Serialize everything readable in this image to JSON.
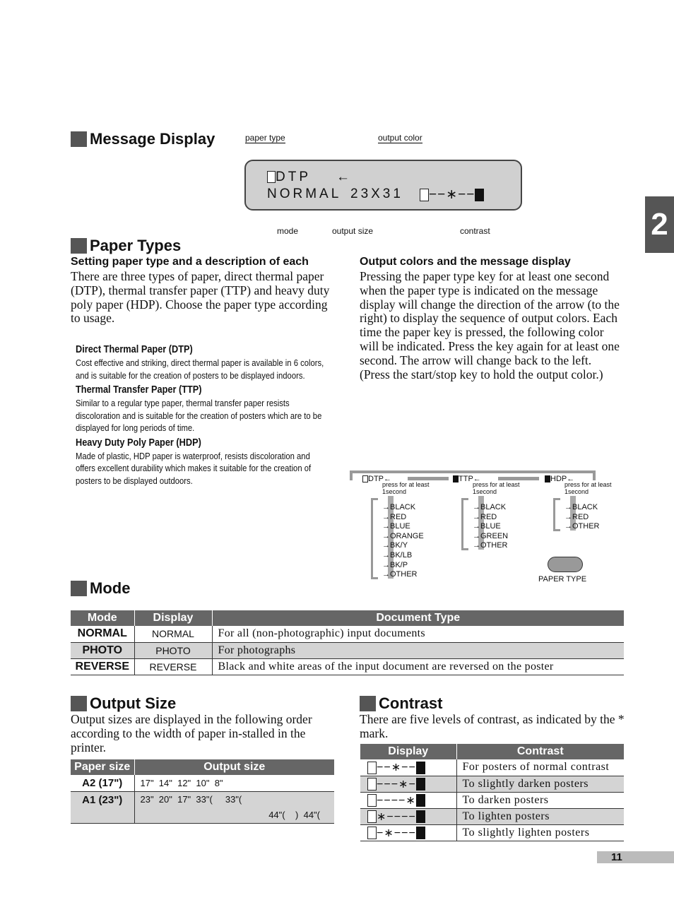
{
  "chapter_tab": "2",
  "page_number": "11",
  "message_display": {
    "title": "Message Display",
    "labels": {
      "paper_type": "paper type",
      "output_color": "output color",
      "mode": "mode",
      "output_size": "output size",
      "contrast": "contrast"
    },
    "line1": "DTP",
    "arrow": "←",
    "line2_mode": "NORMAL",
    "line2_size": "23X31",
    "contrast_pattern": "−−∗−−"
  },
  "paper_types": {
    "title": "Paper Types",
    "subtitle": "Setting paper type and a description of each",
    "intro": "There are three types of paper, direct thermal paper (DTP), thermal transfer paper (TTP) and heavy duty poly paper (HDP). Choose the paper type according to usage.",
    "items": [
      {
        "name": "Direct Thermal Paper (DTP)",
        "desc": "Cost effective and striking, direct thermal paper is available in 6 colors, and is suitable for the creation of posters to be displayed indoors."
      },
      {
        "name": "Thermal Transfer Paper (TTP)",
        "desc": "Similar to a regular type paper, thermal transfer paper resists discoloration and is suitable for the creation of posters which are to be displayed for long periods of time."
      },
      {
        "name": "Heavy Duty Poly Paper (HDP)",
        "desc": "Made of plastic, HDP paper is waterproof, resists discoloration and offers excellent durability which makes it suitable for the creation of posters to be displayed outdoors."
      }
    ]
  },
  "output_colors": {
    "title": "Output colors and the message display",
    "text": "Pressing the paper type key for at least one second when the paper type is indicated on the message display will change the direction of the arrow (to the right) to display the sequence of output colors.  Each time the paper key is pressed, the following color will be indicated. Press the key again for at least one second.  The arrow will change back to the left.  (Press the start/stop key to hold the output color.)",
    "press_note": "press for at least 1second",
    "key_label": "PAPER TYPE",
    "flows": [
      {
        "paper": "DTP←",
        "colors": [
          "BLACK",
          "RED",
          "BLUE",
          "ORANGE",
          "BK/Y",
          "BK/LB",
          "BK/P",
          "OTHER"
        ]
      },
      {
        "paper": "TTP←",
        "colors": [
          "BLACK",
          "RED",
          "BLUE",
          "GREEN",
          "OTHER"
        ]
      },
      {
        "paper": "HDP←",
        "colors": [
          "BLACK",
          "RED",
          "OTHER"
        ]
      }
    ]
  },
  "mode": {
    "title": "Mode",
    "headers": [
      "Mode",
      "Display",
      "Document Type"
    ],
    "rows": [
      [
        "NORMAL",
        "NORMAL",
        "For all (non-photographic) input documents"
      ],
      [
        "PHOTO",
        "PHOTO",
        "For photographs"
      ],
      [
        "REVERSE",
        "REVERSE",
        "Black and white areas of the input document are reversed on the poster"
      ]
    ]
  },
  "output_size": {
    "title": "Output Size",
    "text": "Output sizes are displayed in the following order according to the width of paper in-stalled in the printer.",
    "headers": [
      "Paper size",
      "Output size"
    ],
    "rows": [
      {
        "paper": "A2 (17\")",
        "sizes": "17\"  14\"  12\"  10\"  8\""
      },
      {
        "paper": "A1 (23\")",
        "sizes": "23\"  20\"  17\"  33\"(     33\"(",
        "sizes2": "44\"(    )  44\"("
      }
    ]
  },
  "contrast": {
    "title": "Contrast",
    "text": "There are five levels of contrast, as indicated by the * mark.",
    "headers": [
      "Display",
      "Contrast"
    ],
    "rows": [
      [
        "−−∗−−",
        "For posters of normal contrast"
      ],
      [
        "−−−∗−",
        "To slightly darken posters"
      ],
      [
        "−−−−∗",
        "To darken posters"
      ],
      [
        "∗−−−−",
        "To lighten posters"
      ],
      [
        "−∗−−−",
        "To slightly lighten posters"
      ]
    ]
  },
  "colors": {
    "header_bg": "#666666",
    "row_alt": "#d4d4d4",
    "lcd_bg": "#d0d0d0",
    "tab": "#555555"
  }
}
